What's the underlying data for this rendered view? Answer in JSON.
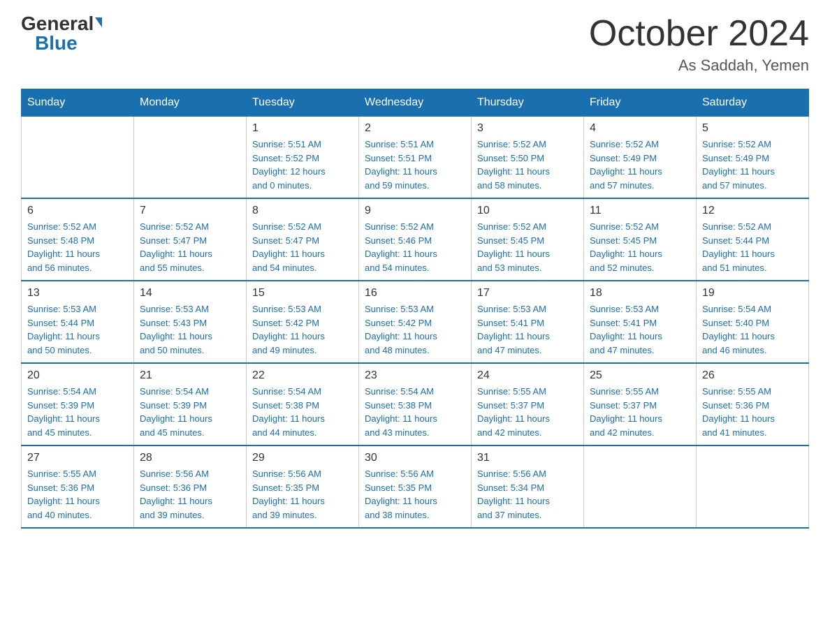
{
  "header": {
    "logo_general": "General",
    "logo_blue": "Blue",
    "month_title": "October 2024",
    "location": "As Saddah, Yemen"
  },
  "days_of_week": [
    "Sunday",
    "Monday",
    "Tuesday",
    "Wednesday",
    "Thursday",
    "Friday",
    "Saturday"
  ],
  "weeks": [
    [
      {
        "day": "",
        "info": ""
      },
      {
        "day": "",
        "info": ""
      },
      {
        "day": "1",
        "info": "Sunrise: 5:51 AM\nSunset: 5:52 PM\nDaylight: 12 hours\nand 0 minutes."
      },
      {
        "day": "2",
        "info": "Sunrise: 5:51 AM\nSunset: 5:51 PM\nDaylight: 11 hours\nand 59 minutes."
      },
      {
        "day": "3",
        "info": "Sunrise: 5:52 AM\nSunset: 5:50 PM\nDaylight: 11 hours\nand 58 minutes."
      },
      {
        "day": "4",
        "info": "Sunrise: 5:52 AM\nSunset: 5:49 PM\nDaylight: 11 hours\nand 57 minutes."
      },
      {
        "day": "5",
        "info": "Sunrise: 5:52 AM\nSunset: 5:49 PM\nDaylight: 11 hours\nand 57 minutes."
      }
    ],
    [
      {
        "day": "6",
        "info": "Sunrise: 5:52 AM\nSunset: 5:48 PM\nDaylight: 11 hours\nand 56 minutes."
      },
      {
        "day": "7",
        "info": "Sunrise: 5:52 AM\nSunset: 5:47 PM\nDaylight: 11 hours\nand 55 minutes."
      },
      {
        "day": "8",
        "info": "Sunrise: 5:52 AM\nSunset: 5:47 PM\nDaylight: 11 hours\nand 54 minutes."
      },
      {
        "day": "9",
        "info": "Sunrise: 5:52 AM\nSunset: 5:46 PM\nDaylight: 11 hours\nand 54 minutes."
      },
      {
        "day": "10",
        "info": "Sunrise: 5:52 AM\nSunset: 5:45 PM\nDaylight: 11 hours\nand 53 minutes."
      },
      {
        "day": "11",
        "info": "Sunrise: 5:52 AM\nSunset: 5:45 PM\nDaylight: 11 hours\nand 52 minutes."
      },
      {
        "day": "12",
        "info": "Sunrise: 5:52 AM\nSunset: 5:44 PM\nDaylight: 11 hours\nand 51 minutes."
      }
    ],
    [
      {
        "day": "13",
        "info": "Sunrise: 5:53 AM\nSunset: 5:44 PM\nDaylight: 11 hours\nand 50 minutes."
      },
      {
        "day": "14",
        "info": "Sunrise: 5:53 AM\nSunset: 5:43 PM\nDaylight: 11 hours\nand 50 minutes."
      },
      {
        "day": "15",
        "info": "Sunrise: 5:53 AM\nSunset: 5:42 PM\nDaylight: 11 hours\nand 49 minutes."
      },
      {
        "day": "16",
        "info": "Sunrise: 5:53 AM\nSunset: 5:42 PM\nDaylight: 11 hours\nand 48 minutes."
      },
      {
        "day": "17",
        "info": "Sunrise: 5:53 AM\nSunset: 5:41 PM\nDaylight: 11 hours\nand 47 minutes."
      },
      {
        "day": "18",
        "info": "Sunrise: 5:53 AM\nSunset: 5:41 PM\nDaylight: 11 hours\nand 47 minutes."
      },
      {
        "day": "19",
        "info": "Sunrise: 5:54 AM\nSunset: 5:40 PM\nDaylight: 11 hours\nand 46 minutes."
      }
    ],
    [
      {
        "day": "20",
        "info": "Sunrise: 5:54 AM\nSunset: 5:39 PM\nDaylight: 11 hours\nand 45 minutes."
      },
      {
        "day": "21",
        "info": "Sunrise: 5:54 AM\nSunset: 5:39 PM\nDaylight: 11 hours\nand 45 minutes."
      },
      {
        "day": "22",
        "info": "Sunrise: 5:54 AM\nSunset: 5:38 PM\nDaylight: 11 hours\nand 44 minutes."
      },
      {
        "day": "23",
        "info": "Sunrise: 5:54 AM\nSunset: 5:38 PM\nDaylight: 11 hours\nand 43 minutes."
      },
      {
        "day": "24",
        "info": "Sunrise: 5:55 AM\nSunset: 5:37 PM\nDaylight: 11 hours\nand 42 minutes."
      },
      {
        "day": "25",
        "info": "Sunrise: 5:55 AM\nSunset: 5:37 PM\nDaylight: 11 hours\nand 42 minutes."
      },
      {
        "day": "26",
        "info": "Sunrise: 5:55 AM\nSunset: 5:36 PM\nDaylight: 11 hours\nand 41 minutes."
      }
    ],
    [
      {
        "day": "27",
        "info": "Sunrise: 5:55 AM\nSunset: 5:36 PM\nDaylight: 11 hours\nand 40 minutes."
      },
      {
        "day": "28",
        "info": "Sunrise: 5:56 AM\nSunset: 5:36 PM\nDaylight: 11 hours\nand 39 minutes."
      },
      {
        "day": "29",
        "info": "Sunrise: 5:56 AM\nSunset: 5:35 PM\nDaylight: 11 hours\nand 39 minutes."
      },
      {
        "day": "30",
        "info": "Sunrise: 5:56 AM\nSunset: 5:35 PM\nDaylight: 11 hours\nand 38 minutes."
      },
      {
        "day": "31",
        "info": "Sunrise: 5:56 AM\nSunset: 5:34 PM\nDaylight: 11 hours\nand 37 minutes."
      },
      {
        "day": "",
        "info": ""
      },
      {
        "day": "",
        "info": ""
      }
    ]
  ]
}
